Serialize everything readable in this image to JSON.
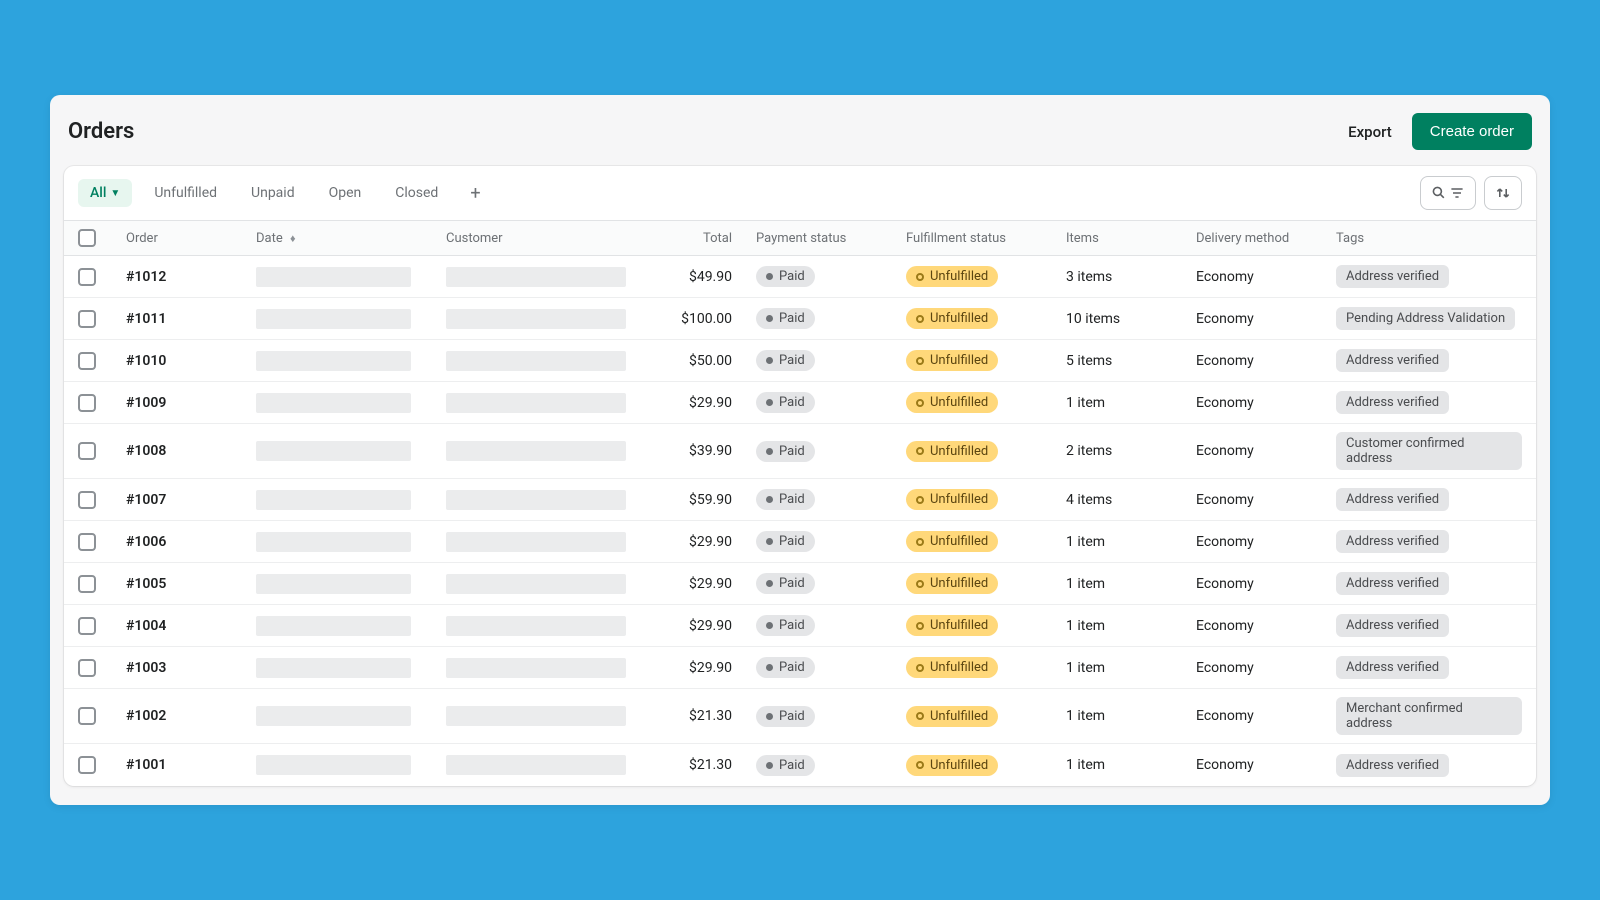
{
  "header": {
    "title": "Orders",
    "export_label": "Export",
    "create_label": "Create order"
  },
  "tabs": {
    "active": "All",
    "items": [
      {
        "label": "All",
        "active": true,
        "has_dropdown": true
      },
      {
        "label": "Unfulfilled"
      },
      {
        "label": "Unpaid"
      },
      {
        "label": "Open"
      },
      {
        "label": "Closed"
      }
    ]
  },
  "columns": {
    "order": "Order",
    "date": "Date",
    "customer": "Customer",
    "total": "Total",
    "payment_status": "Payment status",
    "fulfillment_status": "Fulfillment status",
    "items": "Items",
    "delivery_method": "Delivery method",
    "tags": "Tags"
  },
  "rows": [
    {
      "order": "#1012",
      "total": "$49.90",
      "payment": "Paid",
      "fulfillment": "Unfulfilled",
      "items": "3 items",
      "delivery": "Economy",
      "tag": "Address verified"
    },
    {
      "order": "#1011",
      "total": "$100.00",
      "payment": "Paid",
      "fulfillment": "Unfulfilled",
      "items": "10 items",
      "delivery": "Economy",
      "tag": "Pending Address Validation"
    },
    {
      "order": "#1010",
      "total": "$50.00",
      "payment": "Paid",
      "fulfillment": "Unfulfilled",
      "items": "5 items",
      "delivery": "Economy",
      "tag": "Address verified"
    },
    {
      "order": "#1009",
      "total": "$29.90",
      "payment": "Paid",
      "fulfillment": "Unfulfilled",
      "items": "1 item",
      "delivery": "Economy",
      "tag": "Address verified"
    },
    {
      "order": "#1008",
      "total": "$39.90",
      "payment": "Paid",
      "fulfillment": "Unfulfilled",
      "items": "2 items",
      "delivery": "Economy",
      "tag": "Customer confirmed address"
    },
    {
      "order": "#1007",
      "total": "$59.90",
      "payment": "Paid",
      "fulfillment": "Unfulfilled",
      "items": "4 items",
      "delivery": "Economy",
      "tag": "Address verified"
    },
    {
      "order": "#1006",
      "total": "$29.90",
      "payment": "Paid",
      "fulfillment": "Unfulfilled",
      "items": "1 item",
      "delivery": "Economy",
      "tag": "Address verified"
    },
    {
      "order": "#1005",
      "total": "$29.90",
      "payment": "Paid",
      "fulfillment": "Unfulfilled",
      "items": "1 item",
      "delivery": "Economy",
      "tag": "Address verified"
    },
    {
      "order": "#1004",
      "total": "$29.90",
      "payment": "Paid",
      "fulfillment": "Unfulfilled",
      "items": "1 item",
      "delivery": "Economy",
      "tag": "Address verified"
    },
    {
      "order": "#1003",
      "total": "$29.90",
      "payment": "Paid",
      "fulfillment": "Unfulfilled",
      "items": "1 item",
      "delivery": "Economy",
      "tag": "Address verified"
    },
    {
      "order": "#1002",
      "total": "$21.30",
      "payment": "Paid",
      "fulfillment": "Unfulfilled",
      "items": "1 item",
      "delivery": "Economy",
      "tag": "Merchant confirmed address"
    },
    {
      "order": "#1001",
      "total": "$21.30",
      "payment": "Paid",
      "fulfillment": "Unfulfilled",
      "items": "1 item",
      "delivery": "Economy",
      "tag": "Address verified"
    }
  ]
}
